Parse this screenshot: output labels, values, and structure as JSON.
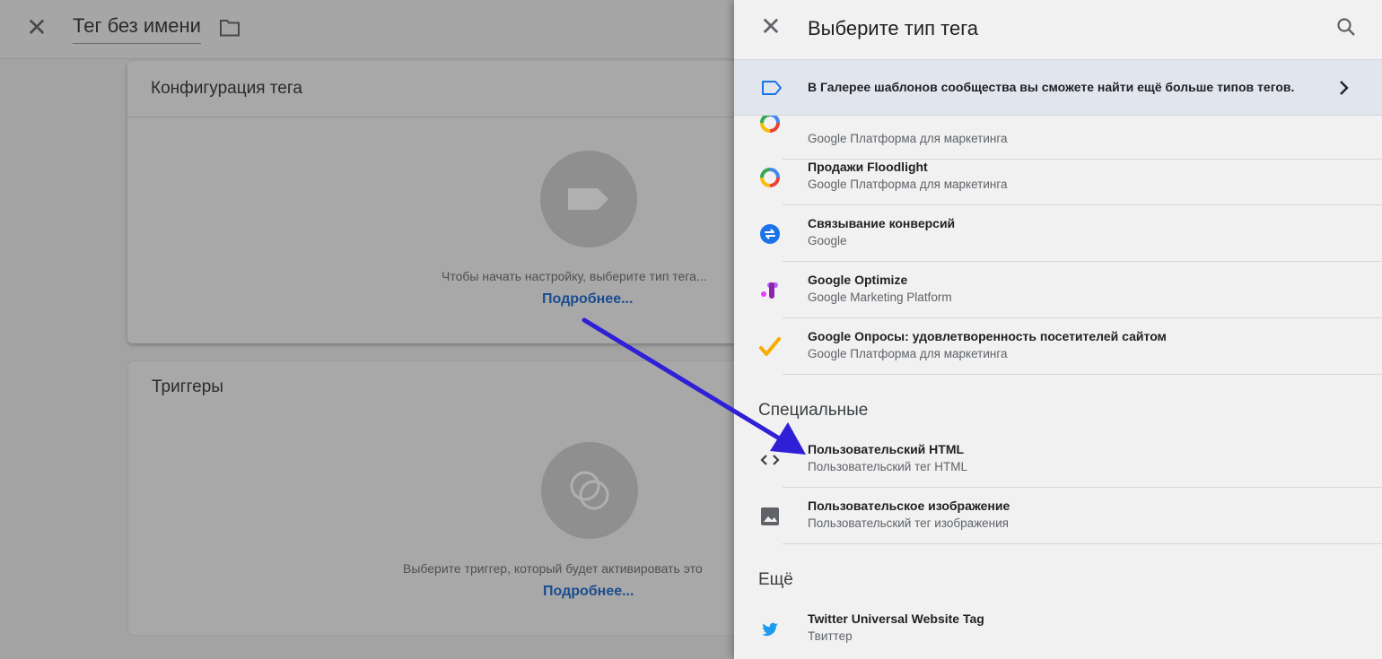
{
  "editor": {
    "title": "Тег без имени",
    "config_card": {
      "heading": "Конфигурация тега",
      "hint": "Чтобы начать настройку, выберите тип тега...",
      "link": "Подробнее..."
    },
    "triggers_card": {
      "heading": "Триггеры",
      "hint": "Выберите триггер, который будет активировать это",
      "link": "Подробнее..."
    }
  },
  "panel": {
    "title": "Выберите тип тега",
    "banner_text": "В Галерее шаблонов сообщества вы сможете найти ещё больше типов тегов.",
    "items_top": [
      {
        "title": "",
        "subtitle": "Google Платформа для маркетинга",
        "icon": "google-marketing-icon"
      },
      {
        "title": "Продажи Floodlight",
        "subtitle": "Google Платформа для маркетинга",
        "icon": "google-marketing-icon"
      },
      {
        "title": "Связывание конверсий",
        "subtitle": "Google",
        "icon": "conversion-linker-icon"
      },
      {
        "title": "Google Optimize",
        "subtitle": "Google Marketing Platform",
        "icon": "optimize-icon"
      },
      {
        "title": "Google Опросы: удовлетворенность посетителей сайтом",
        "subtitle": "Google Платформа для маркетинга",
        "icon": "surveys-check-icon"
      }
    ],
    "section_special": "Специальные",
    "items_special": [
      {
        "title": "Пользовательский HTML",
        "subtitle": "Пользовательский тег HTML",
        "icon": "code-icon"
      },
      {
        "title": "Пользовательское изображение",
        "subtitle": "Пользовательский тег изображения",
        "icon": "image-icon"
      }
    ],
    "section_more": "Ещё",
    "items_more": [
      {
        "title": "Twitter Universal Website Tag",
        "subtitle": "Твиттер",
        "icon": "twitter-icon"
      }
    ]
  },
  "colors": {
    "panel_bg": "#f1f1f1",
    "banner_bg": "#e1e6ee",
    "link": "#1a4d8f",
    "arrow": "#2f1fd6"
  }
}
